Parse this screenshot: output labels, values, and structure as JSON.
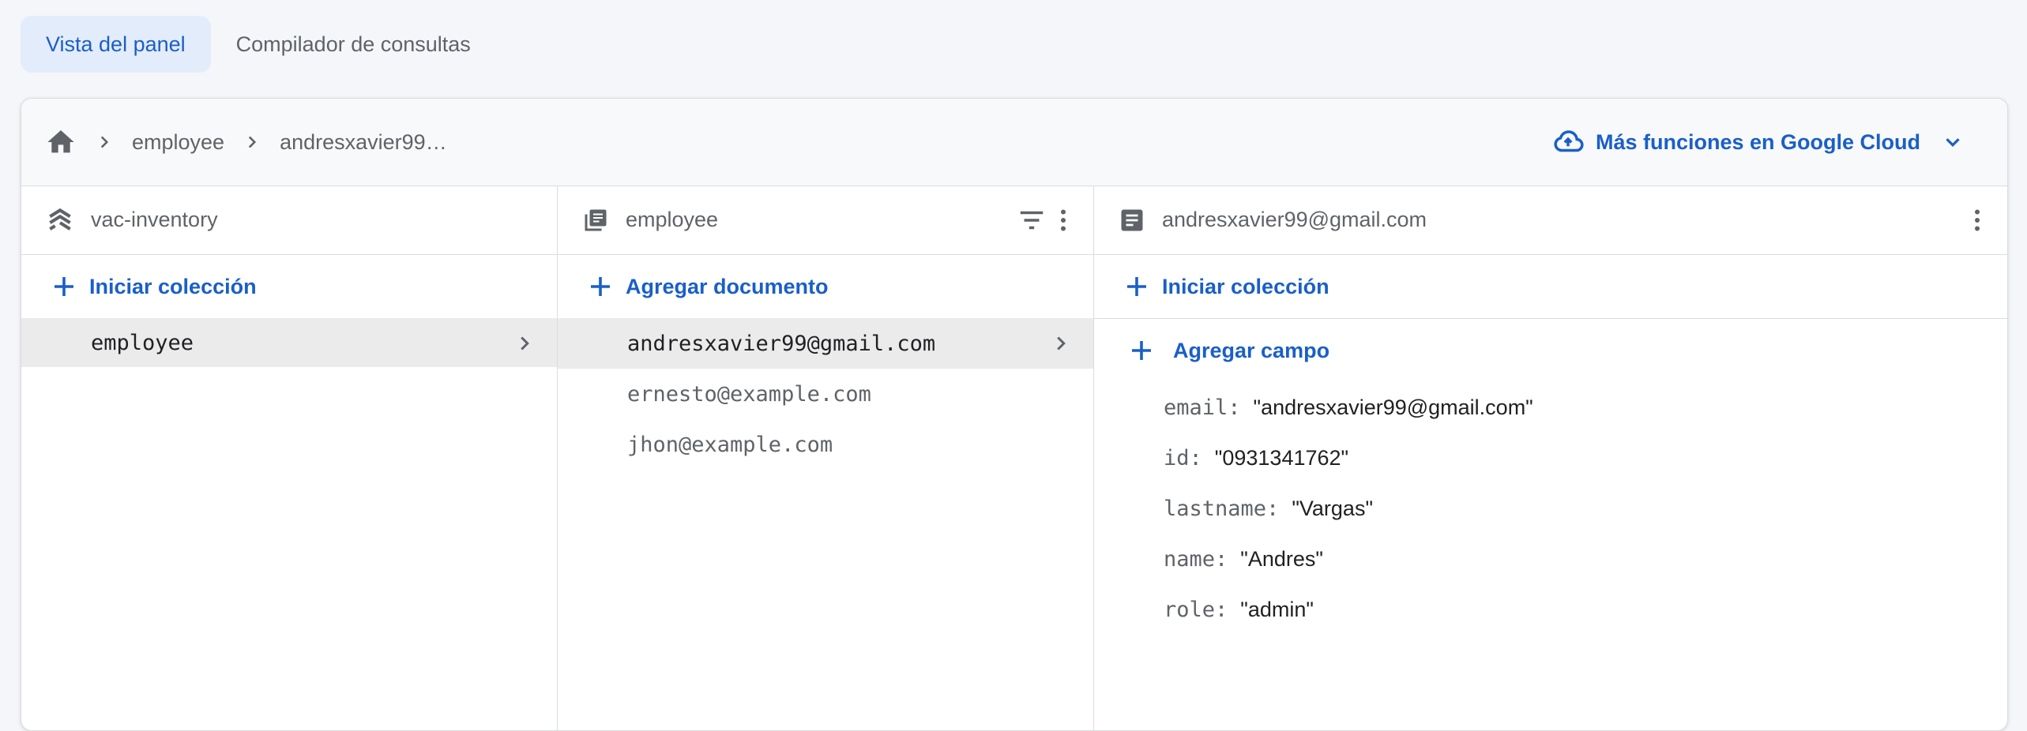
{
  "tabs": [
    {
      "label": "Vista del panel",
      "active": true
    },
    {
      "label": "Compilador de consultas",
      "active": false
    }
  ],
  "breadcrumb": {
    "home_icon": "home-icon",
    "items": [
      "employee",
      "andresxavier99…"
    ]
  },
  "cloud_link": {
    "label": "Más funciones en Google Cloud",
    "icon": "cloud-icon"
  },
  "colors": {
    "accent": "#1a5fc8",
    "tab_active_bg": "#e3ecfb",
    "selected_row": "#ebebeb"
  },
  "columns": {
    "root": {
      "title": "vac-inventory",
      "icon": "database-layers-icon",
      "action": "Iniciar colección",
      "items": [
        {
          "label": "employee",
          "selected": true
        }
      ]
    },
    "collection": {
      "title": "employee",
      "icon": "collection-icon",
      "action": "Agregar documento",
      "items": [
        {
          "label": "andresxavier99@gmail.com",
          "selected": true
        },
        {
          "label": "ernesto@example.com",
          "selected": false
        },
        {
          "label": "jhon@example.com",
          "selected": false
        }
      ]
    },
    "document": {
      "title": "andresxavier99@gmail.com",
      "icon": "document-icon",
      "action_collection": "Iniciar colección",
      "action_field": "Agregar campo",
      "fields": [
        {
          "key": "email:",
          "value": "\"andresxavier99@gmail.com\""
        },
        {
          "key": "id:",
          "value": "\"0931341762\""
        },
        {
          "key": "lastname:",
          "value": "\"Vargas\""
        },
        {
          "key": "name:",
          "value": "\"Andres\""
        },
        {
          "key": "role:",
          "value": "\"admin\""
        }
      ]
    }
  }
}
